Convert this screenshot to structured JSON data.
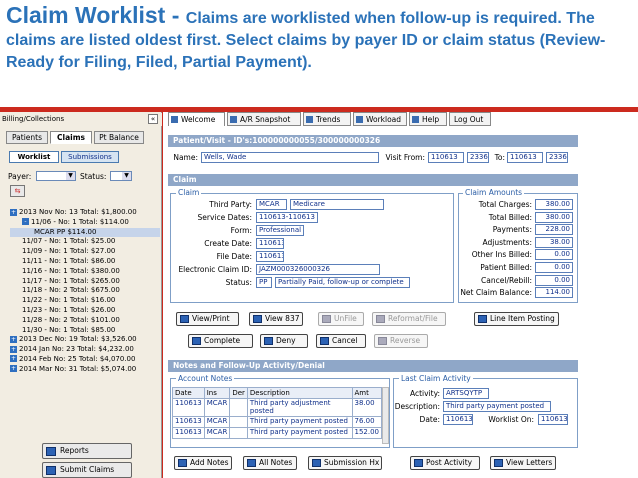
{
  "header": {
    "title": "Claim Worklist - ",
    "description": "Claims are worklisted when follow-up is required. The claims are listed oldest first. Select claims by payer ID or claim status (Review-Ready for Filing, Filed, Partial Payment)."
  },
  "left_panel": {
    "title": "Billing/Collections",
    "collapse_glyph": "«",
    "tabs": [
      "Patients",
      "Claims",
      "Pt Balance"
    ],
    "subtabs": [
      "Worklist",
      "Submissions"
    ],
    "payer_label": "Payer:",
    "status_label": "Status:",
    "tree": [
      {
        "text": "2013 Nov No: 13 Total: $1,800.00",
        "level": 0,
        "sq": "+"
      },
      {
        "text": "11/06 - No: 1 Total: $114.00",
        "level": 1,
        "sq": "-"
      },
      {
        "text": "MCAR PP $114.00",
        "level": 2,
        "sq": ""
      },
      {
        "text": "11/07 - No: 1 Total: $25.00",
        "level": 1,
        "sq": ""
      },
      {
        "text": "11/09 - No: 1 Total: $27.00",
        "level": 1,
        "sq": ""
      },
      {
        "text": "11/11 - No: 1 Total: $86.00",
        "level": 1,
        "sq": ""
      },
      {
        "text": "11/16 - No: 1 Total: $380.00",
        "level": 1,
        "sq": ""
      },
      {
        "text": "11/17 - No: 1 Total: $265.00",
        "level": 1,
        "sq": ""
      },
      {
        "text": "11/18 - No: 2 Total: $675.00",
        "level": 1,
        "sq": ""
      },
      {
        "text": "11/22 - No: 1 Total: $16.00",
        "level": 1,
        "sq": ""
      },
      {
        "text": "11/23 - No: 1 Total: $26.00",
        "level": 1,
        "sq": ""
      },
      {
        "text": "11/28 - No: 2 Total: $101.00",
        "level": 1,
        "sq": ""
      },
      {
        "text": "11/30 - No: 1 Total: $85.00",
        "level": 1,
        "sq": ""
      },
      {
        "text": "2013 Dec No: 19 Total: $3,526.00",
        "level": 0,
        "sq": "+"
      },
      {
        "text": "2014 Jan No: 23 Total: $4,232.00",
        "level": 0,
        "sq": "+"
      },
      {
        "text": "2014 Feb No: 25 Total: $4,070.00",
        "level": 0,
        "sq": "+"
      },
      {
        "text": "2014 Mar No: 31 Total: $5,074.00",
        "level": 0,
        "sq": "+"
      }
    ],
    "reports_button": "Reports",
    "submit_button": "Submit Claims"
  },
  "top_tabs": [
    "Welcome",
    "A/R Snapshot",
    "Trends",
    "Workload",
    "Help",
    "Log Out"
  ],
  "patient_visit": {
    "title": "Patient/Visit - ID's:100000000055/300000000326",
    "name_label": "Name:",
    "name_value": "Wells, Wade",
    "visit_from_label": "Visit From:",
    "visit_from_1": "110613",
    "visit_from_2": "2336",
    "to_label": "To:",
    "to_1": "110613",
    "to_2": "2336"
  },
  "claim": {
    "section_title": "Claim",
    "group_title": "Claim",
    "third_party_label": "Third Party:",
    "third_party_code": "MCAR",
    "third_party_name": "Medicare",
    "service_dates_label": "Service Dates:",
    "service_dates_value": "110613-110613",
    "form_label": "Form:",
    "form_value": "Professional",
    "create_date_label": "Create Date:",
    "create_date_value": "110613",
    "file_date_label": "File Date:",
    "file_date_value": "110613",
    "ecid_label": "Electronic Claim ID:",
    "ecid_value": "JAZM000326000326",
    "status_label": "Status:",
    "status_code": "PP",
    "status_text": "Partially Paid, follow-up or complete"
  },
  "amounts": {
    "group_title": "Claim Amounts",
    "rows": [
      {
        "label": "Total Charges:",
        "value": "380.00"
      },
      {
        "label": "Total Billed:",
        "value": "380.00"
      },
      {
        "label": "Payments:",
        "value": "228.00"
      },
      {
        "label": "Adjustments:",
        "value": "38.00"
      },
      {
        "label": "Other Ins Billed:",
        "value": "0.00"
      },
      {
        "label": "Patient Billed:",
        "value": "0.00"
      },
      {
        "label": "Cancel/Rebill:",
        "value": "0.00"
      },
      {
        "label": "Net Claim Balance:",
        "value": "114.00"
      }
    ]
  },
  "buttons": {
    "view_print": "View/Print",
    "view_837": "View 837",
    "unfile": "UnFile",
    "reformat": "Reformat/File",
    "line_item": "Line Item Posting",
    "complete": "Complete",
    "deny": "Deny",
    "cancel": "Cancel",
    "reverse": "Reverse",
    "add_notes": "Add Notes",
    "all_notes": "All Notes",
    "submission_hx": "Submission Hx",
    "post_activity": "Post Activity",
    "view_letters": "View Letters"
  },
  "notes": {
    "section_title": "Notes and Follow-Up Activity/Denial",
    "account_notes_title": "Account Notes",
    "columns": [
      "Date",
      "Ins",
      "Der",
      "Description",
      "Amt"
    ],
    "rows": [
      {
        "date": "110613",
        "ins": "MCAR",
        "der": "",
        "desc": "Third party adjustment posted",
        "amt": "38.00"
      },
      {
        "date": "110613",
        "ins": "MCAR",
        "der": "",
        "desc": "Third party payment posted",
        "amt": "76.00"
      },
      {
        "date": "110613",
        "ins": "MCAR",
        "der": "",
        "desc": "Third party payment posted",
        "amt": "152.00"
      }
    ],
    "last_activity_title": "Last Claim Activity",
    "activity_label": "Activity:",
    "activity_value": "ARTSQYTP",
    "description_label": "Description:",
    "description_value": "Third party payment posted",
    "date_label": "Date:",
    "date_value": "110613",
    "worklist_on_label": "Worklist On:",
    "worklist_on_value": "110613"
  },
  "colors": {
    "accent": "#2b72b8",
    "frame": "#cc2a1e",
    "section": "#8fa7c8"
  }
}
